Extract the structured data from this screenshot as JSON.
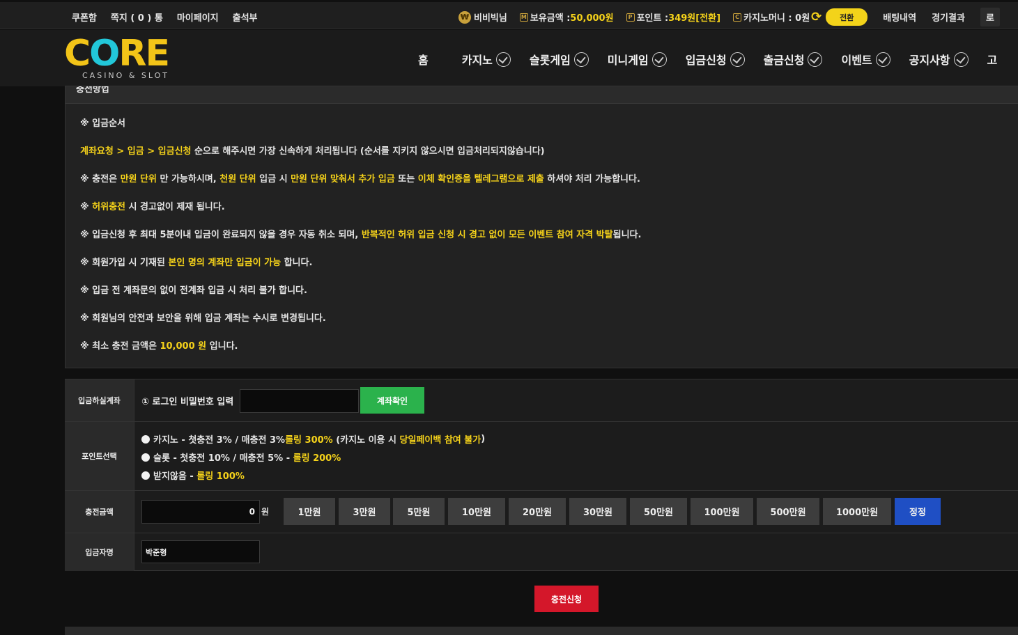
{
  "topbar": {
    "links": [
      "쿠폰함",
      "쪽지 ( 0 ) 통",
      "마이페이지",
      "출석부"
    ],
    "user": {
      "icon": "coin-icon",
      "name": "비비빅님"
    },
    "balance": {
      "icon": "m-icon",
      "label": "보유금액 : ",
      "value": "50,000원"
    },
    "point": {
      "icon": "p-icon",
      "label": "포인트 : ",
      "value": "349원",
      "suffix": " [전환]"
    },
    "casino": {
      "icon": "c-icon",
      "label": "카지노머니 : 0원"
    },
    "convert_label": "전환",
    "bet_history": "배팅내역",
    "results": "경기결과",
    "login_partial": "로"
  },
  "logo": {
    "word": "CORE",
    "tagline": "CASINO & SLOT"
  },
  "nav": {
    "home": "홈",
    "items": [
      "카지노",
      "슬롯게임",
      "미니게임",
      "입금신청",
      "출금신청",
      "이벤트",
      "공지사항"
    ],
    "partial": "고"
  },
  "notice": {
    "title": "충전방법",
    "l1": "※ 입금순서",
    "l2a": "계좌요청 > 입금 > 입금신청",
    "l2b": " 순으로 해주시면 가장 신속하게 처리됩니다 (순서를 지키지 않으시면 입금처리되지않습니다)",
    "l3a": "※ 충전은 ",
    "l3b": "만원 단위",
    "l3c": " 만 가능하시며, ",
    "l3d": "천원 단위",
    "l3e": " 입금 시 ",
    "l3f": "만원 단위 맞춰서 추가 입금",
    "l3g": " 또는 ",
    "l3h": "이체 확인증을 텔레그램으로 제출",
    "l3i": " 하셔야 처리 가능합니다.",
    "l4a": "※ ",
    "l4b": "허위충전",
    "l4c": " 시 경고없이 제재 됩니다.",
    "l5a": "※ 입금신청 후 최대 5분이내 입금이 완료되지 않을 경우 자동 취소 되며, ",
    "l5b": "반복적인 허위 입금 신청 시 경고 없이 모든 이벤트 참여 자격 박탈",
    "l5c": "됩니다.",
    "l6a": "※ 회원가입 시 기재된 ",
    "l6b": "본인 명의 계좌만 입금이 가능",
    "l6c": " 합니다.",
    "l7": "※ 입금 전 계좌문의 없이 전계좌 입금 시 처리 불가 합니다.",
    "l8": "※ 회원님의 안전과 보안을 위해 입금 계좌는 수시로 변경됩니다.",
    "l9a": "※ 최소 충전 금액은 ",
    "l9b": "10,000 원",
    "l9c": " 입니다."
  },
  "form": {
    "account_label": "입금하실계좌",
    "password_label": "① 로그인 비밀번호 입력",
    "password_value": "",
    "check_button": "계좌확인",
    "point_label": "포인트선택",
    "opt1a": "카지노 - 첫충전 3% / 매충전 3% ",
    "opt1b": "롤링 300%",
    "opt1c": " (카지노 이용 시 ",
    "opt1d": "당일페이백 참여 불가",
    "opt1e": ")",
    "opt2a": "슬롯 - 첫충전 10% / 매충전 5% - ",
    "opt2b": "롤링 200%",
    "opt3a": "받지않음 - ",
    "opt3b": "롤링 100%",
    "amount_label": "충전금액",
    "amount_value": "0",
    "amount_unit": "원",
    "amount_buttons": [
      "1만원",
      "3만원",
      "5만원",
      "10만원",
      "20만원",
      "30만원",
      "50만원",
      "100만원",
      "500만원",
      "1000만원"
    ],
    "reset_button": "정정",
    "depositor_label": "입금자명",
    "depositor_value": "박준형",
    "submit": "충전신청"
  },
  "colors": {
    "accent_yellow": "#f5d21a",
    "green": "#2bb24c",
    "red": "#d4172a",
    "blue": "#1f4fc4"
  }
}
